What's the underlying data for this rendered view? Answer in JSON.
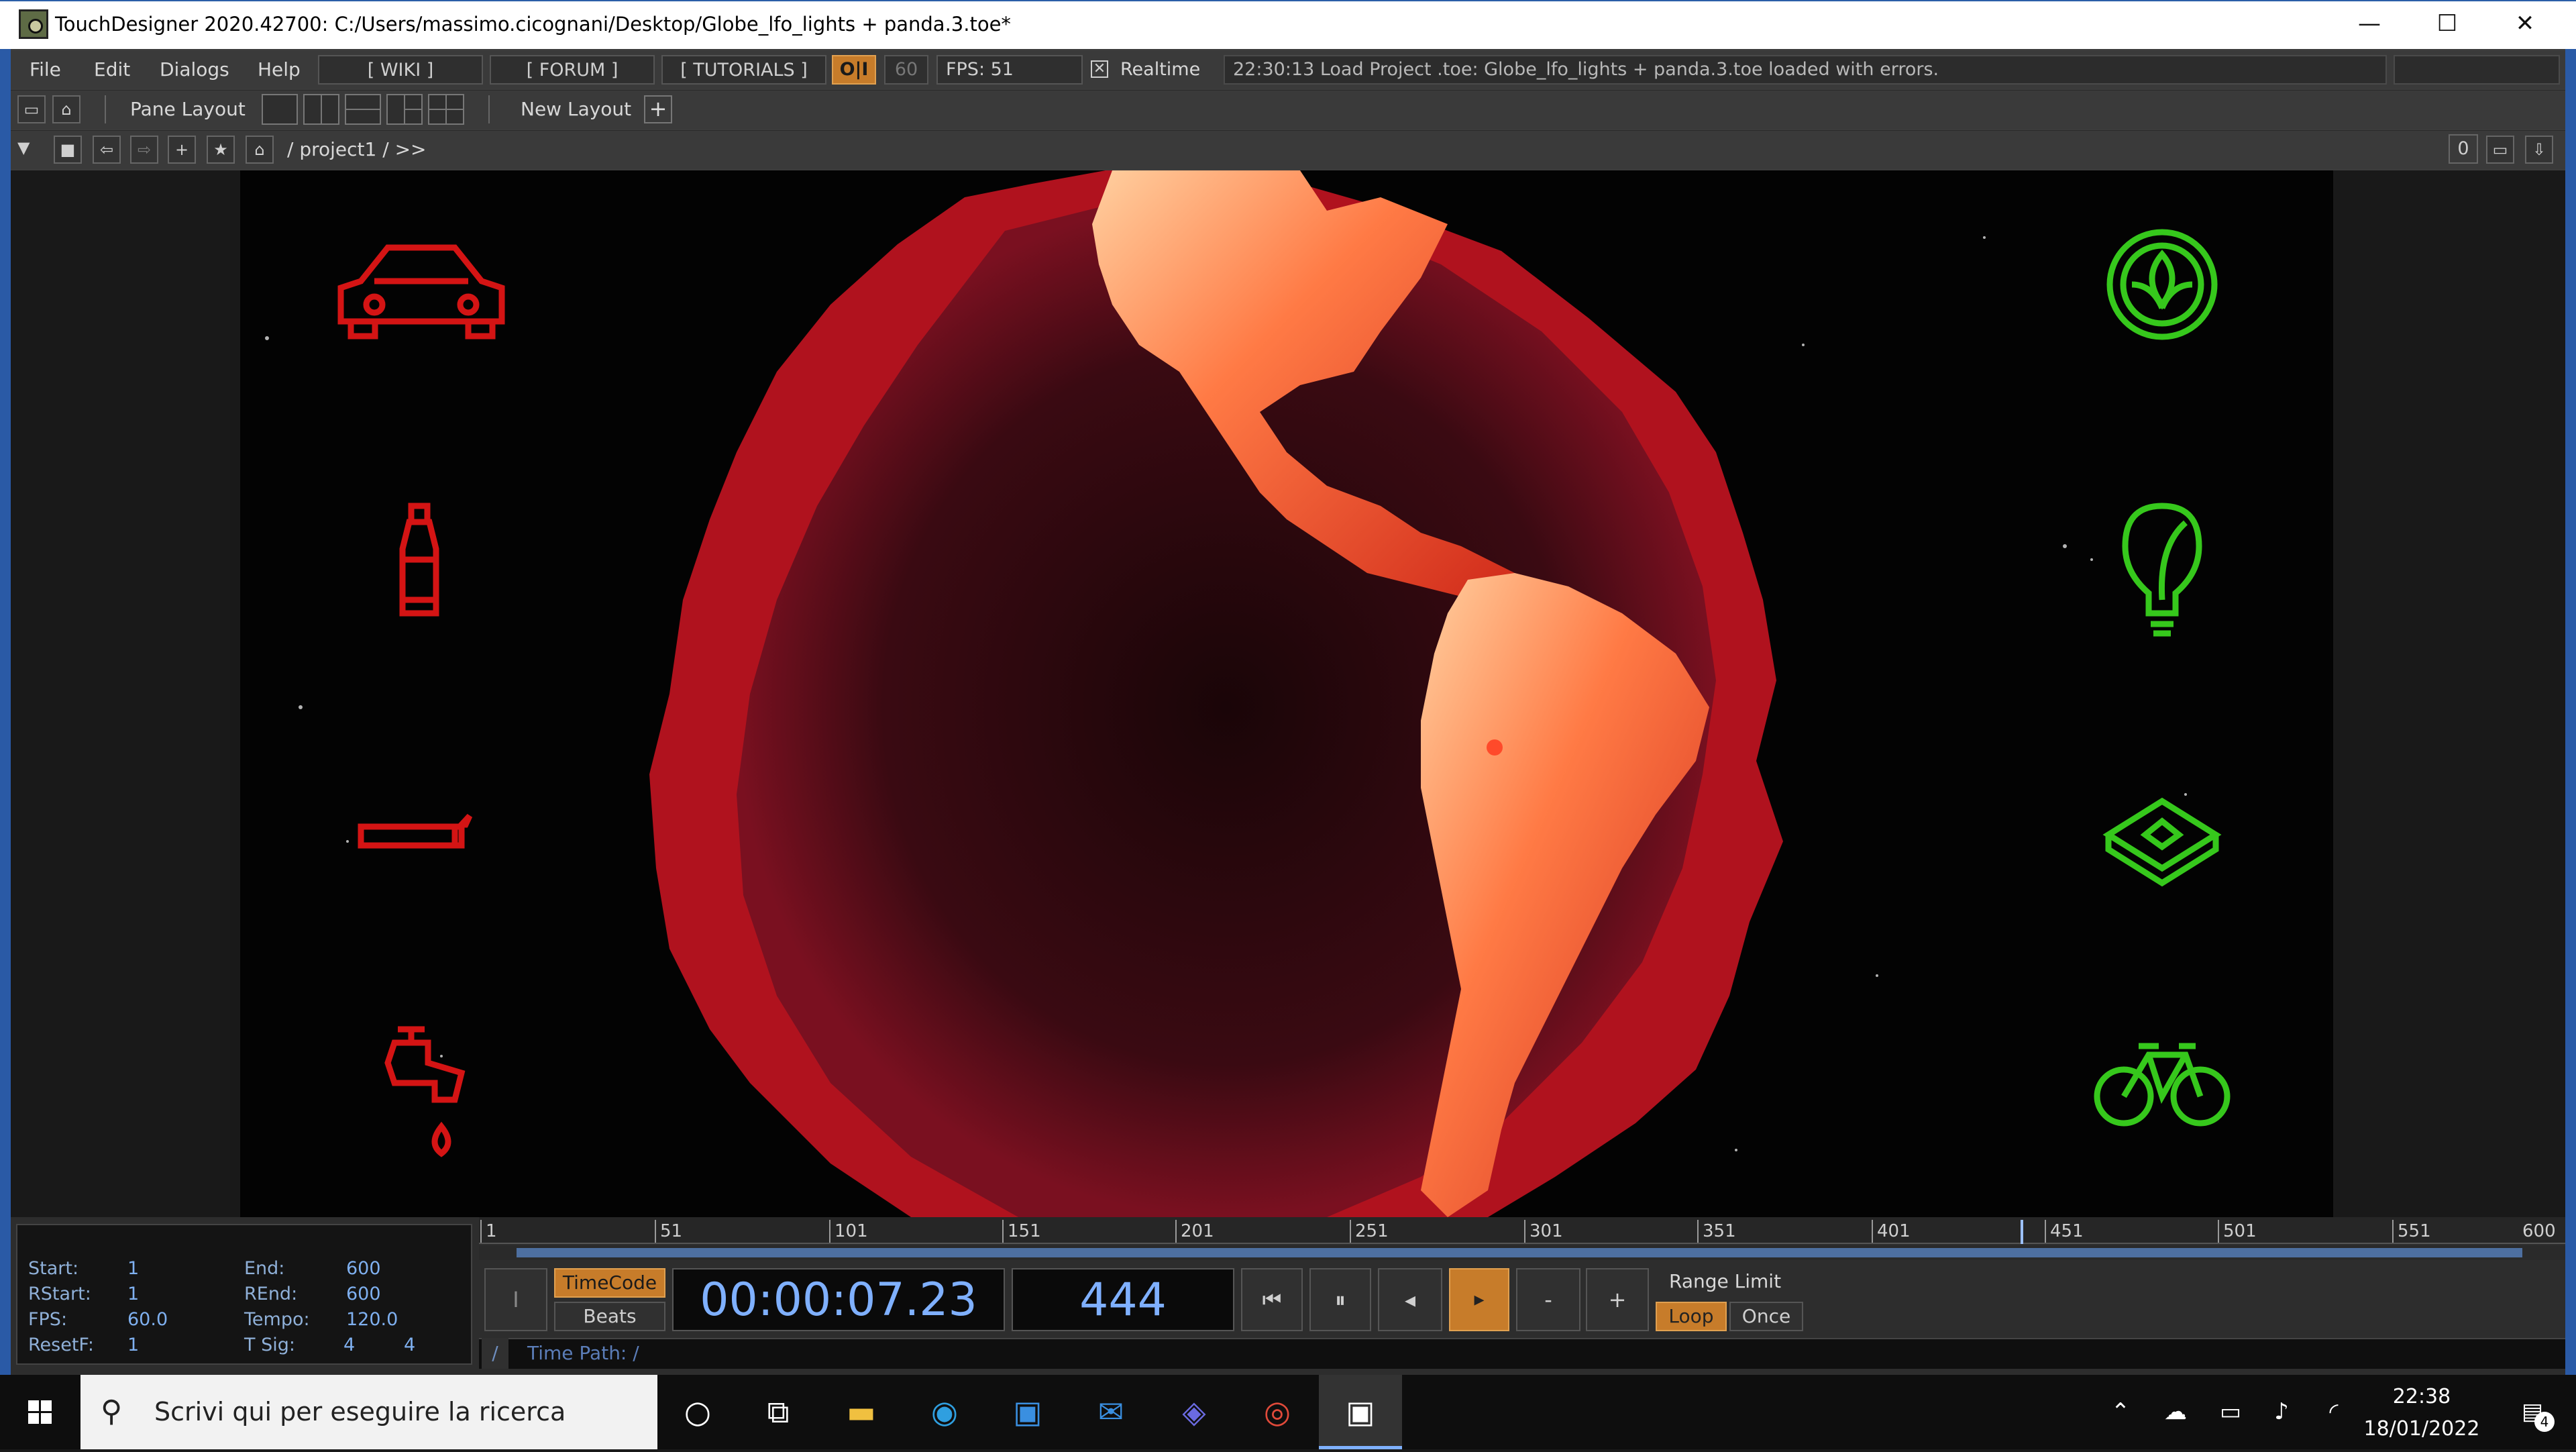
{
  "window": {
    "title": "TouchDesigner 2020.42700: C:/Users/massimo.cicognani/Desktop/Globe_lfo_lights + panda.3.toe*",
    "minimize_glyph": "—",
    "maximize_glyph": "☐",
    "close_glyph": "✕"
  },
  "menubar": {
    "items": [
      "File",
      "Edit",
      "Dialogs",
      "Help"
    ],
    "wiki": "[ WIKI ]",
    "forum": "[ FORUM ]",
    "tutorials": "[ TUTORIALS ]",
    "oi": "O|I",
    "fps_cap": "60",
    "fps_label": "FPS:  51",
    "realtime_check": "✕",
    "realtime": "Realtime",
    "status": "22:30:13 Load Project .toe: Globe_lfo_lights + panda.3.toe loaded with errors."
  },
  "panebar": {
    "pane_layout": "Pane Layout",
    "new_layout": "New Layout",
    "plus": "+"
  },
  "pathbar": {
    "path": "/ project1 / >>",
    "counter": "0"
  },
  "viewer": {
    "left_icons": [
      "car-icon",
      "bottle-icon",
      "cigarette-icon",
      "faucet-icon"
    ],
    "right_icons": [
      "leaf-badge-icon",
      "eco-bulb-icon",
      "stamp-icon",
      "bicycle-icon"
    ],
    "accent_red": "#d41414",
    "accent_green": "#36c81c"
  },
  "info": {
    "start_label": "Start:",
    "start": "1",
    "end_label": "End:",
    "end": "600",
    "rstart_label": "RStart:",
    "rstart": "1",
    "rend_label": "REnd:",
    "rend": "600",
    "fps_label": "FPS:",
    "fps": "60.0",
    "tempo_label": "Tempo:",
    "tempo": "120.0",
    "resetf_label": "ResetF:",
    "resetf": "1",
    "tsig_label": "T Sig:",
    "tsig_a": "4",
    "tsig_b": "4"
  },
  "timeline": {
    "ticks": [
      "1",
      "51",
      "101",
      "151",
      "201",
      "251",
      "301",
      "351",
      "401",
      "451",
      "501",
      "551",
      "600"
    ],
    "timecode_btn": "TimeCode",
    "beats_btn": "Beats",
    "timecode": "00:00:07.23",
    "frame": "444",
    "range_limit": "Range Limit",
    "loop": "Loop",
    "once": "Once",
    "time_path_slash": "/",
    "time_path": "Time Path: /",
    "btn_i": "I",
    "btn_first": "⏮",
    "btn_pause": "⏸",
    "btn_back": "◂",
    "btn_play": "▸",
    "btn_minus": "-",
    "btn_plus": "+"
  },
  "taskbar": {
    "search_placeholder": "Scrivi qui per eseguire la ricerca",
    "time": "22:38",
    "date": "18/01/2022",
    "notif_count": "4"
  }
}
